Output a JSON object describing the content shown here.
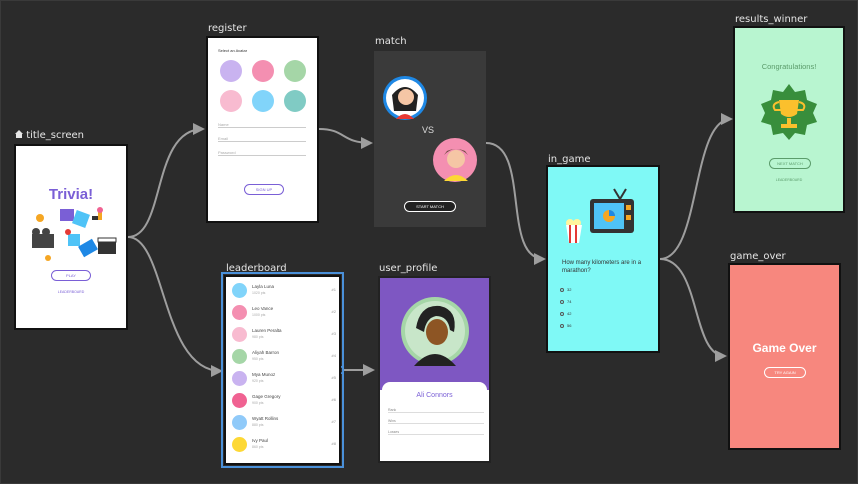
{
  "labels": {
    "title_screen": "title_screen",
    "register": "register",
    "match": "match",
    "in_game": "in_game",
    "results_winner": "results_winner",
    "game_over": "game_over",
    "leaderboard": "leaderboard",
    "user_profile": "user_profile"
  },
  "title_screen": {
    "title": "Trivia!",
    "play_button": "PLAY",
    "leaderboard_link": "LEADERBOARD"
  },
  "register": {
    "prompt": "Select an Avatar",
    "fields": [
      "Name",
      "Email",
      "Password"
    ],
    "signup_button": "SIGN UP"
  },
  "match": {
    "vs": "VS",
    "start_button": "START MATCH"
  },
  "in_game": {
    "question": "How many kilometers are in a marathon?",
    "options": [
      "32",
      "74",
      "42",
      "56"
    ]
  },
  "results_winner": {
    "title": "Congratulations!",
    "next_button": "NEXT MATCH",
    "leaderboard_link": "LEADERBOARD"
  },
  "game_over": {
    "title": "Game Over",
    "try_again_button": "TRY AGAIN"
  },
  "leaderboard": {
    "rows": [
      {
        "name": "Layla Luna",
        "score": "1020 pts",
        "rank": "#1"
      },
      {
        "name": "Leo Vance",
        "score": "1000 pts",
        "rank": "#2"
      },
      {
        "name": "Lauren Peralta",
        "score": "980 pts",
        "rank": "#3"
      },
      {
        "name": "Aliyah Barron",
        "score": "950 pts",
        "rank": "#4"
      },
      {
        "name": "Mya Munoz",
        "score": "920 pts",
        "rank": "#5"
      },
      {
        "name": "Gage Gregory",
        "score": "900 pts",
        "rank": "#6"
      },
      {
        "name": "Wyatt Rollins",
        "score": "880 pts",
        "rank": "#7"
      },
      {
        "name": "Ivy Paul",
        "score": "860 pts",
        "rank": "#8"
      }
    ]
  },
  "user_profile": {
    "name": "Ali Connors",
    "rows": [
      "Rank",
      "Wins",
      "Losses"
    ]
  },
  "colors": {
    "canvas": "#2b2b2b",
    "accent": "#7a5fd6",
    "in_game_bg": "#7ff9f6",
    "winner_bg": "#b8f5d0",
    "game_over_bg": "#f7877e",
    "profile_header": "#7e57c2",
    "arrow": "#9e9e9e",
    "selection": "#4a90d9"
  },
  "icons": [
    "home-icon",
    "trophy-icon",
    "tv-icon",
    "popcorn-icon",
    "film-camera-icon",
    "clapperboard-icon"
  ]
}
